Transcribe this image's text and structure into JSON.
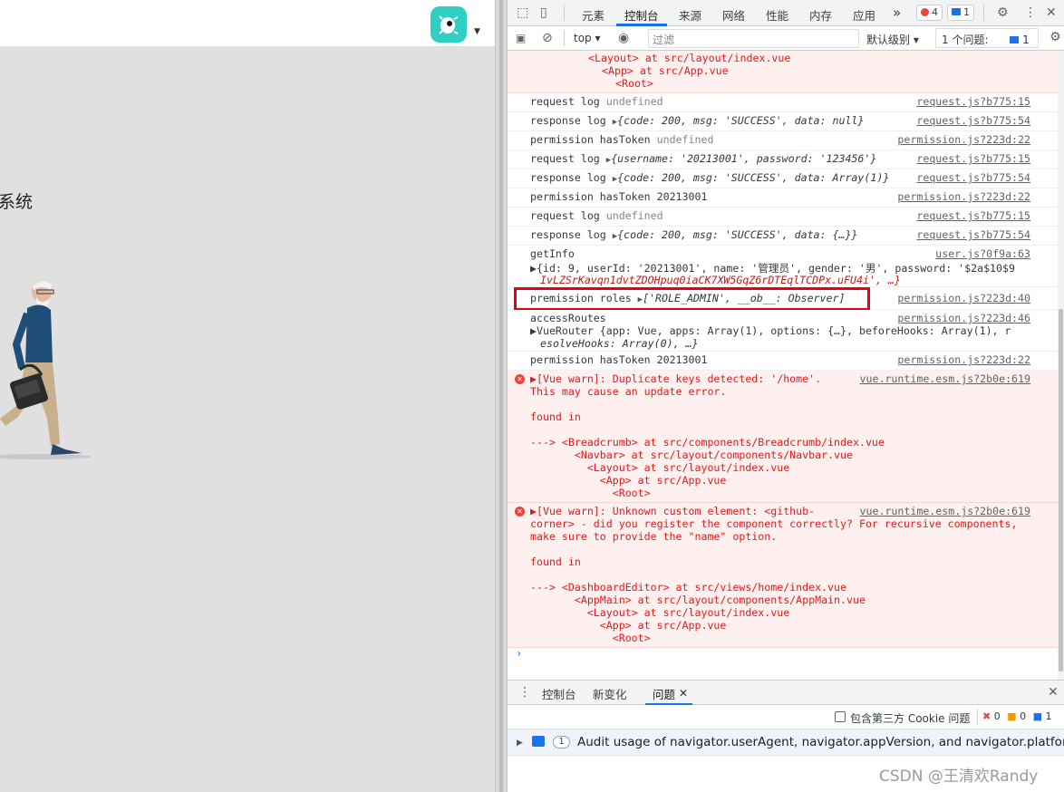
{
  "app": {
    "title_fragment": "系统"
  },
  "devtools": {
    "tabs": [
      "元素",
      "控制台",
      "来源",
      "网络",
      "性能",
      "内存",
      "应用"
    ],
    "more": "»",
    "error_count": "4",
    "message_count": "1",
    "context": "top ▾",
    "filter_placeholder": "过滤",
    "level": "默认级别 ▾",
    "issues_label": "1 个问题:",
    "issues_count": "1"
  },
  "console": {
    "top_stack": [
      "<Layout> at src/layout/index.vue",
      "<App> at src/App.vue",
      "<Root>"
    ],
    "rows": [
      {
        "label": "request log",
        "value": "undefined",
        "src": "request.js?b775:15"
      },
      {
        "label": "response log",
        "value": "{code: 200, msg: 'SUCCESS', data: null}",
        "src": "request.js?b775:54"
      },
      {
        "label": "permission hasToken",
        "value": "undefined",
        "src": "permission.js?223d:22"
      },
      {
        "label": "request log",
        "value": "{username: '20213001', password: '123456'}",
        "src": "request.js?b775:15"
      },
      {
        "label": "response log",
        "value": "{code: 200, msg: 'SUCCESS', data: Array(1)}",
        "src": "request.js?b775:54"
      },
      {
        "label": "permission hasToken",
        "value": "20213001",
        "src": "permission.js?223d:22"
      },
      {
        "label": "request log",
        "value": "undefined",
        "src": "request.js?b775:15"
      },
      {
        "label": "response log",
        "value": "{code: 200, msg: 'SUCCESS', data: {…}}",
        "src": "request.js?b775:54"
      }
    ],
    "getinfo": {
      "label": "getInfo",
      "line1": "{id: 9, userId: '20213001', name: '管理员', gender: '男', password: '$2a$10$9",
      "line2": "IvLZSrKavqn1dvtZDOHpuq0iaCK7XW5GqZ6rDTEqlTCDPx.uFU4i', …}",
      "src": "user.js?0f9a:63"
    },
    "roles": {
      "label": "premission roles",
      "value": "['ROLE_ADMIN', __ob__: Observer]",
      "src": "permission.js?223d:40"
    },
    "routes": {
      "label": "accessRoutes",
      "line1": "VueRouter {app: Vue, apps: Array(1), options: {…}, beforeHooks: Array(1), r",
      "line2": "esolveHooks: Array(0), …}",
      "src": "permission.js?223d:46"
    },
    "hastoken2": {
      "label": "permission hasToken",
      "value": "20213001",
      "src": "permission.js?223d:22"
    },
    "warn1": {
      "lines": [
        "[Vue warn]: Duplicate keys detected: '/home'.",
        "This may cause an update error.",
        "",
        "found in",
        "",
        "---> <Breadcrumb> at src/components/Breadcrumb/index.vue",
        "       <Navbar> at src/layout/components/Navbar.vue",
        "         <Layout> at src/layout/index.vue",
        "           <App> at src/App.vue",
        "             <Root>"
      ],
      "src": "vue.runtime.esm.js?2b0e:619"
    },
    "warn2": {
      "lines": [
        "[Vue warn]: Unknown custom element: <github-",
        "corner> - did you register the component correctly? For recursive components,",
        "make sure to provide the \"name\" option.",
        "",
        "found in",
        "",
        "---> <DashboardEditor> at src/views/home/index.vue",
        "       <AppMain> at src/layout/components/AppMain.vue",
        "         <Layout> at src/layout/index.vue",
        "           <App> at src/App.vue",
        "             <Root>"
      ],
      "src": "vue.runtime.esm.js?2b0e:619"
    },
    "prompt": "›"
  },
  "drawer": {
    "tabs": [
      "控制台",
      "新变化",
      "问题"
    ],
    "cookie_label": "包含第三方 Cookie 问题",
    "counts": [
      "0",
      "0",
      "1"
    ],
    "issue_count": "1",
    "issue_text": "Audit usage of navigator.userAgent, navigator.appVersion, and navigator.platform"
  },
  "watermark": "CSDN @王清欢Randy",
  "colors": {
    "accent": "#1a73e8",
    "error": "#e31b1b",
    "highlight": "#e60012",
    "avatar": "#2fd0c3"
  }
}
